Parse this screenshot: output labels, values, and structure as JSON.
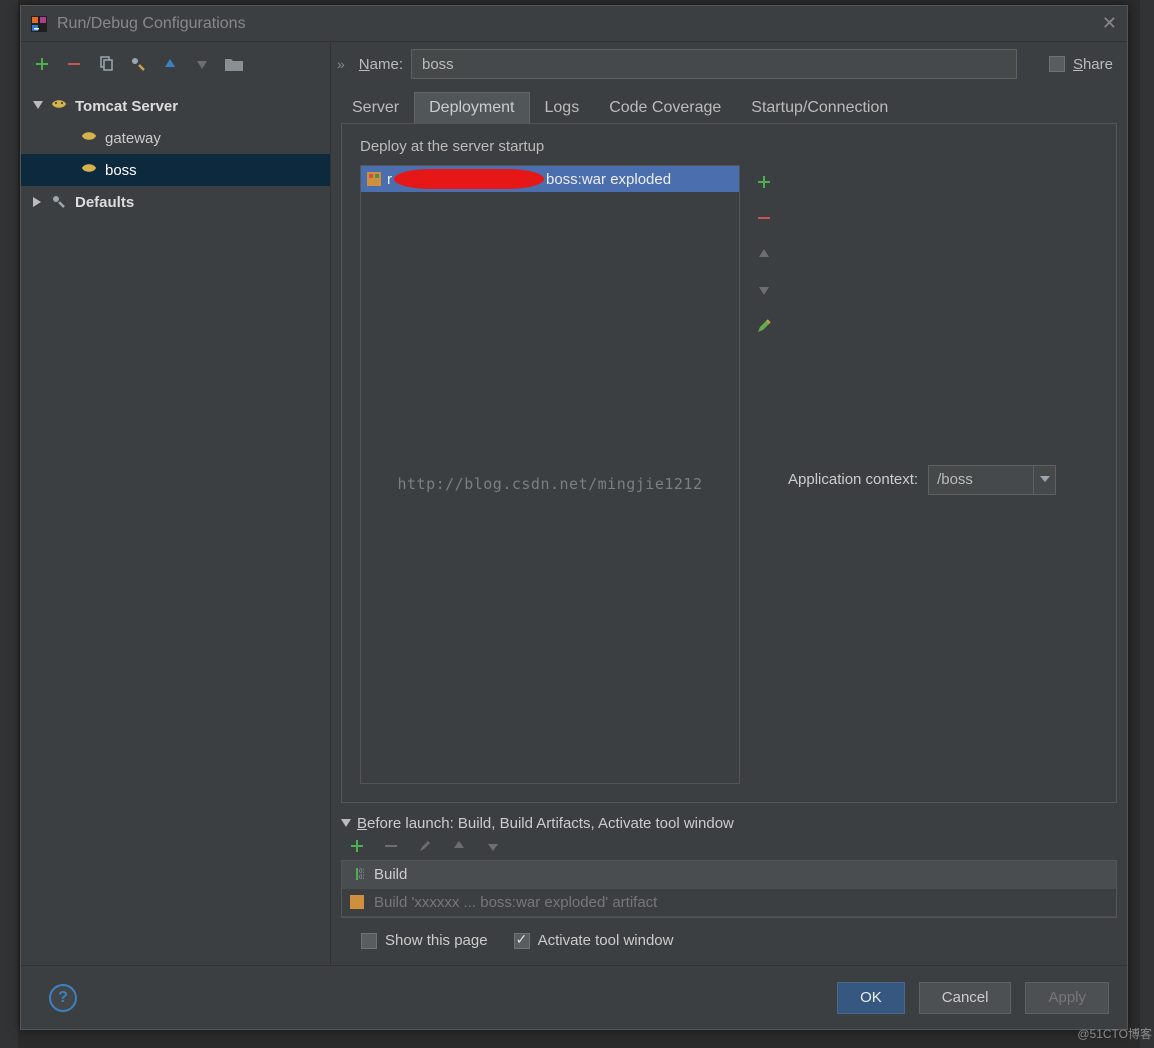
{
  "dialog": {
    "title": "Run/Debug Configurations"
  },
  "name_row": {
    "label_u": "N",
    "label_rest": "ame:",
    "value": "boss",
    "share_u": "S",
    "share_rest": "hare"
  },
  "tree": {
    "group": "Tomcat Server",
    "items": [
      "gateway",
      "boss"
    ],
    "defaults": "Defaults"
  },
  "tabs": [
    "Server",
    "Deployment",
    "Logs",
    "Code Coverage",
    "Startup/Connection"
  ],
  "active_tab": "Deployment",
  "deploy": {
    "section_label": "Deploy at the server startup",
    "item_prefix": "r",
    "item_suffix": "boss:war exploded",
    "watermark": "http://blog.csdn.net/mingjie1212",
    "app_ctx_label": "Application context:",
    "app_ctx_value": "/boss"
  },
  "before_launch": {
    "header_u": "B",
    "header_rest": "efore launch: Build, Build Artifacts, Activate tool window",
    "rows": [
      "Build",
      "Build 'xxxxxx ... boss:war exploded' artifact"
    ]
  },
  "footer_opts": {
    "show_page": "Show this page",
    "activate": "Activate tool window"
  },
  "buttons": {
    "ok": "OK",
    "cancel": "Cancel",
    "apply": "Apply"
  },
  "corner_wm": "@51CTO博客"
}
